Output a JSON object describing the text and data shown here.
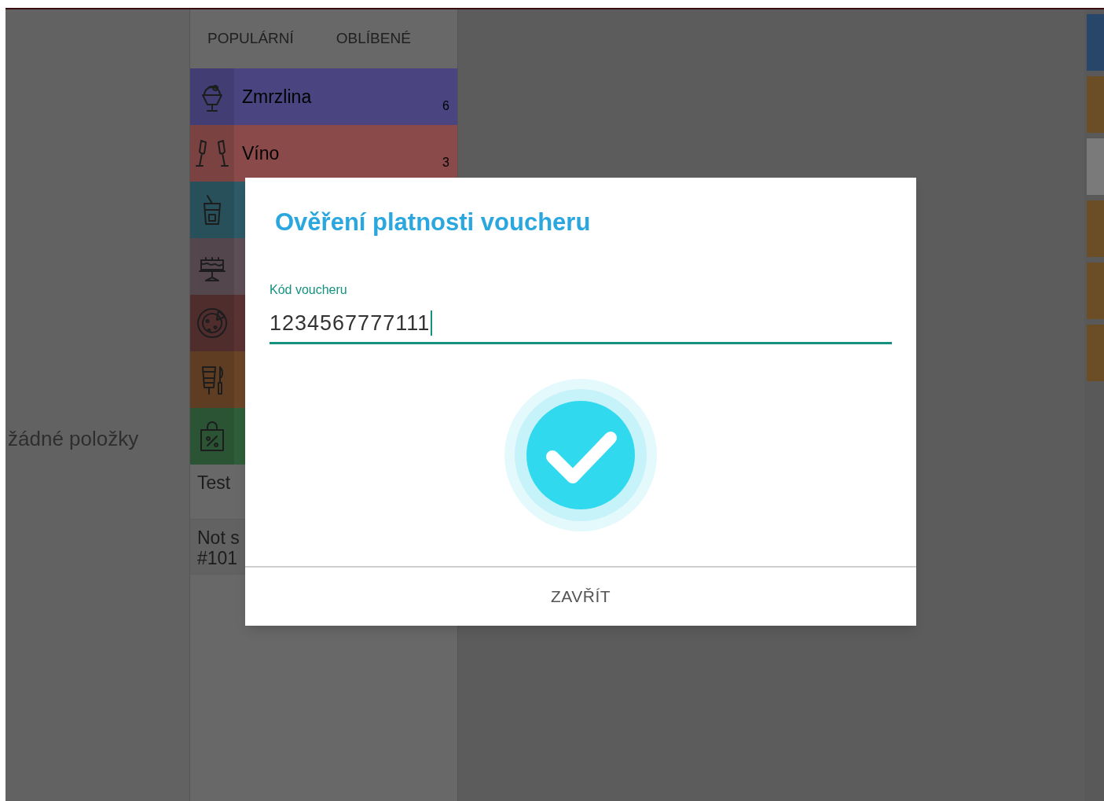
{
  "empty_message": "žádné položky",
  "tabs": [
    {
      "label": "POPULÁRNÍ"
    },
    {
      "label": "OBLÍBENÉ"
    }
  ],
  "categories": [
    {
      "kind": "icecream",
      "name": "Zmrzlina",
      "count": "6",
      "color": "#4a4580"
    },
    {
      "kind": "wine",
      "name": "Víno",
      "count": "3",
      "color": "#8a4a4a"
    },
    {
      "kind": "drink",
      "color": "#2d5a66"
    },
    {
      "kind": "cake",
      "color": "#5e4f56"
    },
    {
      "kind": "pizza",
      "color": "#5a3333"
    },
    {
      "kind": "kebab",
      "color": "#6a4528"
    },
    {
      "kind": "bag",
      "color": "#2f5e3a"
    }
  ],
  "items": [
    {
      "lines": [
        "Test"
      ]
    },
    {
      "lines": [
        "Not s",
        "#101"
      ]
    }
  ],
  "side_tiles": [
    {
      "color": "#27466a"
    },
    {
      "color": "#6b4d26"
    },
    {
      "color": "#7a7a7a"
    },
    {
      "color": "#6b4d26"
    },
    {
      "color": "#6b4d26"
    },
    {
      "color": "#6b4d26"
    }
  ],
  "dialog": {
    "title": "Ověření platnosti voucheru",
    "field": {
      "label": "Kód voucheru",
      "value": "1234567777111"
    },
    "valid": true,
    "button": "ZAVŘÍT"
  }
}
